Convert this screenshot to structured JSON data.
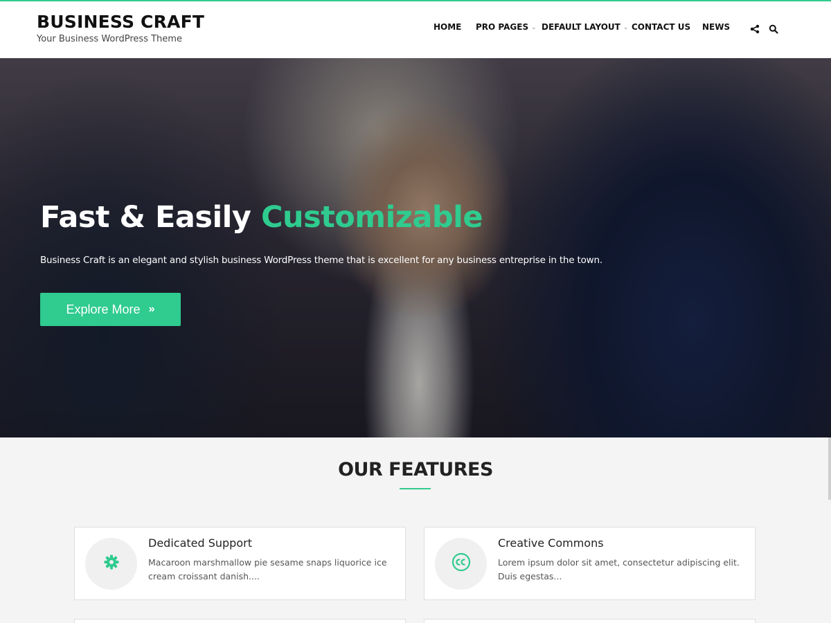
{
  "brand": {
    "title": "BUSINESS CRAFT",
    "tagline": "Your Business WordPress Theme"
  },
  "nav": {
    "items": [
      {
        "label": "HOME",
        "has_dropdown": false
      },
      {
        "label": "PRO PAGES",
        "has_dropdown": true
      },
      {
        "label": "DEFAULT LAYOUT",
        "has_dropdown": true
      },
      {
        "label": "CONTACT US",
        "has_dropdown": false
      },
      {
        "label": "NEWS",
        "has_dropdown": false
      }
    ],
    "icons": [
      "share-icon",
      "search-icon"
    ]
  },
  "hero": {
    "title_plain": "Fast & Easily ",
    "title_accent": "Customizable",
    "subtitle": "Business Craft is an elegant and stylish business WordPress theme that is excellent for any business entreprise in the town.",
    "button_label": "Explore More",
    "button_icon": "double-chevron-right-icon"
  },
  "features": {
    "heading": "OUR FEATURES",
    "cards": [
      {
        "icon": "gear-icon",
        "title": "Dedicated Support",
        "text": "Macaroon marshmallow pie sesame snaps liquorice ice cream croissant danish...."
      },
      {
        "icon": "creative-commons-icon",
        "title": "Creative Commons",
        "text": "Lorem ipsum dolor sit amet, consectetur adipiscing elit. Duis egestas..."
      }
    ]
  },
  "colors": {
    "accent": "#2fcb8f",
    "text_dark": "#111111",
    "background": "#f4f4f4"
  }
}
